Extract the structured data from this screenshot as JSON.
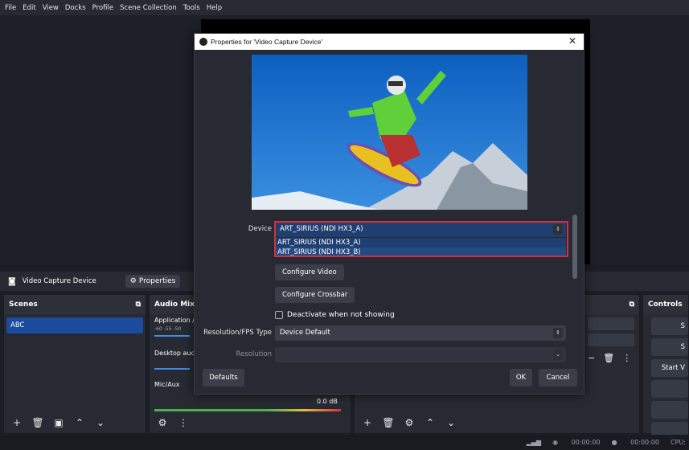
{
  "menu": [
    "File",
    "Edit",
    "View",
    "Docks",
    "Profile",
    "Scene Collection",
    "Tools",
    "Help"
  ],
  "source_bar": {
    "source_name": "Video Capture Device",
    "properties_label": "Properties"
  },
  "scenes": {
    "title": "Scenes",
    "items": [
      "ABC"
    ]
  },
  "audio_mixer": {
    "title": "Audio Mix",
    "channels": [
      "Application /",
      "Desktop auc",
      "Mic/Aux"
    ],
    "mic_level": "0.0 dB",
    "ticks": "-60  -55  -50"
  },
  "controls": {
    "title": "Controls",
    "start_label": "Start V"
  },
  "status": {
    "rec_time": "00:00:00",
    "stream_time": "00:00:00",
    "cpu": "CPU: "
  },
  "dialog": {
    "title": "Properties for 'Video Capture Device'",
    "device_label": "Device",
    "device_value": "ART_SIRIUS (NDI HX3_A)",
    "device_options": [
      "ART_SIRIUS (NDI HX3_A)",
      "ART_SIRIUS (NDI HX3_B)"
    ],
    "configure_video": "Configure Video",
    "configure_crossbar": "Configure Crossbar",
    "deactivate_label": "Deactivate when not showing",
    "res_fps_label": "Resolution/FPS Type",
    "res_fps_value": "Device Default",
    "resolution_label": "Resolution",
    "defaults": "Defaults",
    "ok": "OK",
    "cancel": "Cancel"
  },
  "colors": {
    "accent": "#1b4b9c",
    "highlight": "#d6303a"
  }
}
